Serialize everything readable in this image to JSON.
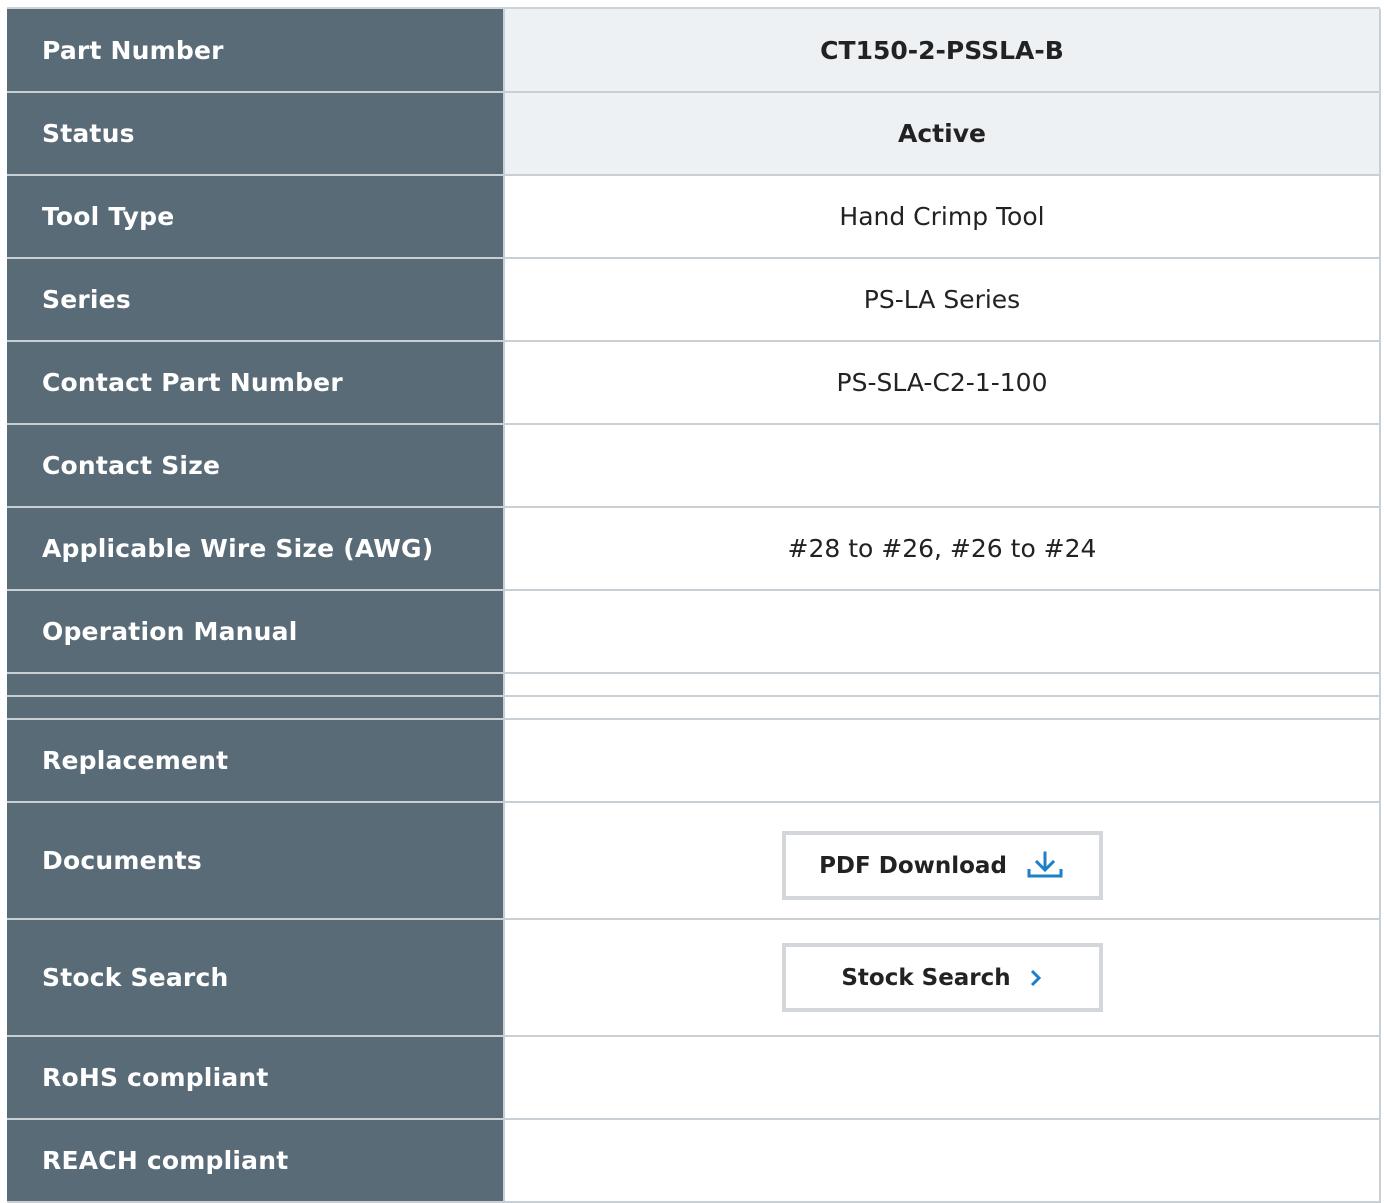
{
  "rows": [
    {
      "label": "Part Number",
      "value": "CT150-2-PSSLA-B"
    },
    {
      "label": "Status",
      "value": "Active"
    },
    {
      "label": "Tool Type",
      "value": "Hand Crimp Tool"
    },
    {
      "label": "Series",
      "value": "PS-LA Series"
    },
    {
      "label": "Contact Part Number",
      "value": "PS-SLA-C2-1-100"
    },
    {
      "label": "Contact Size",
      "value": ""
    },
    {
      "label": "Applicable Wire Size (AWG)",
      "value": "#28 to #26, #26 to #24"
    },
    {
      "label": "Operation Manual",
      "value": ""
    },
    {
      "label": "Replacement",
      "value": ""
    },
    {
      "label": "Documents",
      "button": "PDF Download",
      "icon": "download-icon"
    },
    {
      "label": "Stock Search",
      "button": "Stock Search",
      "icon": "chevron-right-icon"
    },
    {
      "label": "RoHS compliant",
      "value": ""
    },
    {
      "label": "REACH compliant",
      "value": ""
    }
  ],
  "colors": {
    "header_bg": "#5a6b78",
    "highlight_bg": "#eef1f4",
    "accent": "#1b7fc9",
    "border": "#c8cfd5"
  }
}
